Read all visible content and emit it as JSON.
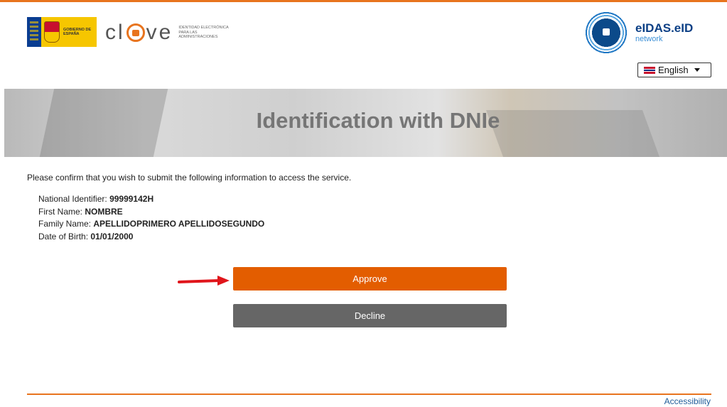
{
  "header": {
    "gov_logo_text": "GOBIERNO DE ESPAÑA",
    "clave_word_pre": "cl",
    "clave_word_post": "ve",
    "clave_subtitle": "IDENTIDAD ELECTRÓNICA PARA LAS ADMINISTRACIONES",
    "eidas_title": "eIDAS.eID",
    "eidas_subtitle": "network",
    "language": "English"
  },
  "banner": {
    "title": "Identification with DNIe"
  },
  "main": {
    "intro": "Please confirm that you wish to submit the following information to access the service.",
    "attributes": [
      {
        "label": "National Identifier: ",
        "value": "99999142H"
      },
      {
        "label": "First Name: ",
        "value": "NOMBRE"
      },
      {
        "label": "Family Name: ",
        "value": "APELLIDOPRIMERO APELLIDOSEGUNDO"
      },
      {
        "label": "Date of Birth: ",
        "value": "01/01/2000"
      }
    ],
    "approve_label": "Approve",
    "decline_label": "Decline"
  },
  "footer": {
    "accessibility_label": "Accessibility"
  },
  "colors": {
    "accent": "#e8741e",
    "approve": "#e35d00",
    "decline": "#666666",
    "arrow": "#e0151b"
  }
}
